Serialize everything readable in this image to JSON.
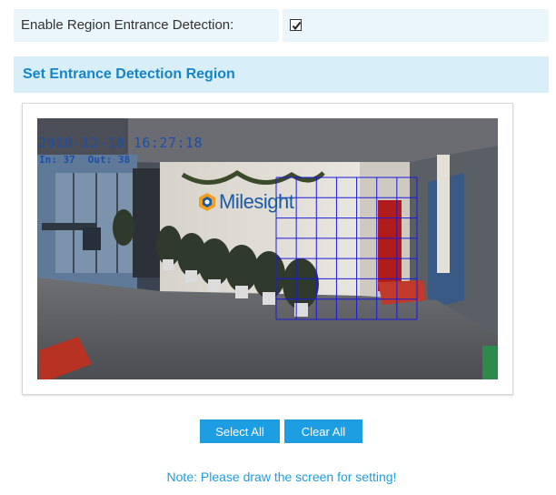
{
  "enable": {
    "label": "Enable Region Entrance Detection:",
    "checked": true
  },
  "section": {
    "title": "Set Entrance Detection Region"
  },
  "video": {
    "timestamp": "2018-12-18  16:27:18",
    "in_count": "In: 37",
    "out_count": "Out: 38",
    "brand_text": "Milesight",
    "grid_color": "#1a1ad8"
  },
  "buttons": {
    "select_all": "Select All",
    "clear_all": "Clear All"
  },
  "note": "Note: Please draw the screen for setting!",
  "colors": {
    "accent": "#1d9de2",
    "header_text": "#1584c8",
    "row_bg": "#eaf6fc",
    "header_bg": "#d8eef9"
  }
}
